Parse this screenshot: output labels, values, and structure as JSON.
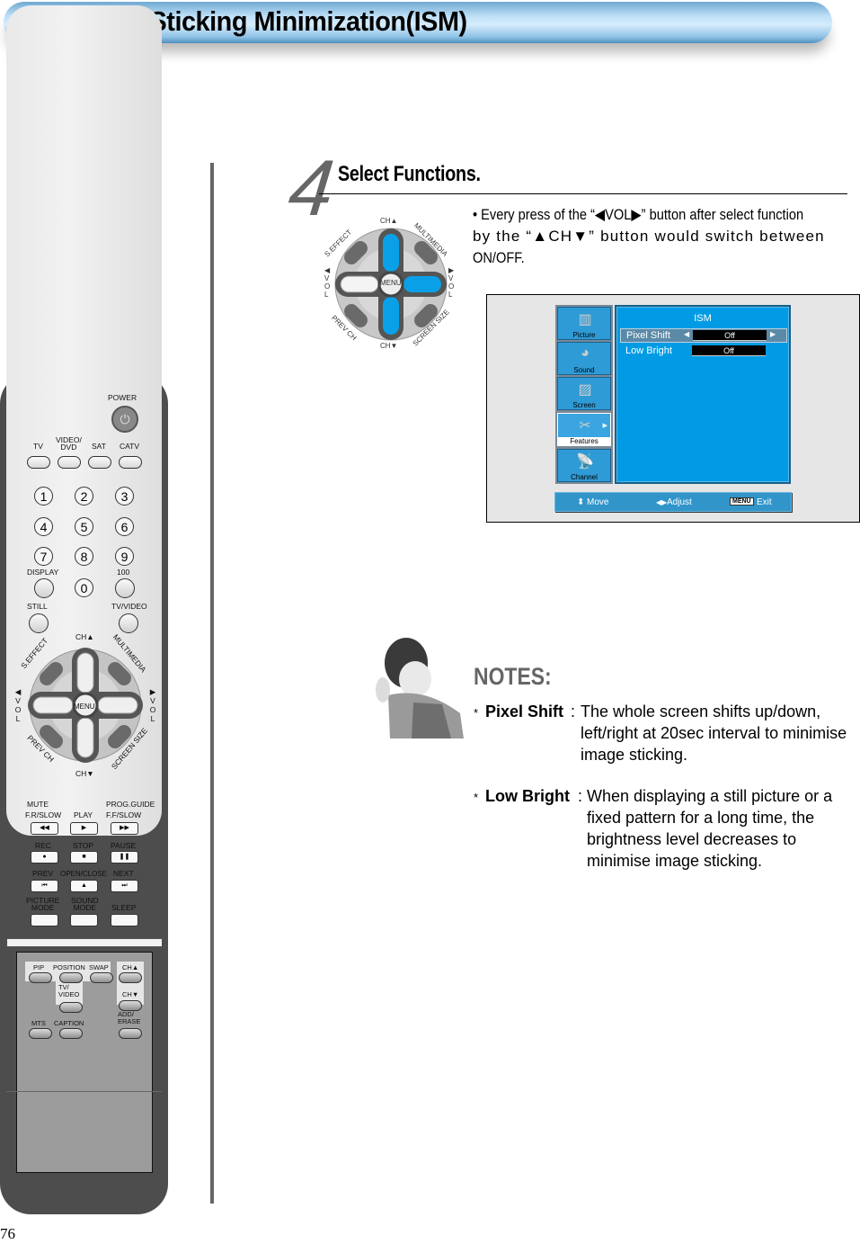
{
  "header": {
    "title": "Image Sticking Minimization(ISM)"
  },
  "step": {
    "number": "4",
    "title": "Select Functions.",
    "desc_line1": "• Every press of the “◀VOL▶” button after select function",
    "desc_line2": "by the “▲CH▼” button would switch between",
    "desc_line3": "ON/OFF."
  },
  "dpad": {
    "center": "MENU",
    "ch_up": "CH▲",
    "ch_down": "CH▼",
    "top_left": "S.EFFECT",
    "top_right": "MULTIMEDIA",
    "bottom_left": "PREV CH",
    "bottom_right": "SCREEN SIZE",
    "vol_left": "◀ V O L",
    "vol_right": "▶ V O L"
  },
  "osd": {
    "sidebar": [
      {
        "label": "Picture",
        "icon": "picture-icon",
        "active": false
      },
      {
        "label": "Sound",
        "icon": "sound-icon",
        "active": false
      },
      {
        "label": "Screen",
        "icon": "screen-icon",
        "active": false
      },
      {
        "label": "Features",
        "icon": "features-icon",
        "active": true
      },
      {
        "label": "Channel",
        "icon": "channel-icon",
        "active": false
      }
    ],
    "title": "ISM",
    "rows": [
      {
        "name": "Pixel Shift",
        "value": "Off",
        "selected": true
      },
      {
        "name": "Low Bright",
        "value": "Off",
        "selected": false
      }
    ],
    "footer": {
      "move": "Move",
      "adjust": "Adjust",
      "menu_chip": "MENU",
      "exit": "Exit"
    },
    "colors": {
      "panel": "#009be4",
      "frame": "#1a5f8a"
    }
  },
  "notes": {
    "title": "NOTES:",
    "items": [
      {
        "term": "Pixel Shift",
        "lines": [
          "The whole screen shifts up/down,",
          "left/right at 20sec interval to minimise",
          "image sticking."
        ]
      },
      {
        "term": "Low Bright",
        "lines": [
          "When displaying a still picture or a",
          "fixed pattern for a long time, the",
          "brightness level decreases to",
          "minimise image sticking."
        ]
      }
    ]
  },
  "remote": {
    "power": "POWER",
    "sources": [
      "TV",
      "VIDEO/\nDVD",
      "SAT",
      "CATV"
    ],
    "digits": [
      "1",
      "2",
      "3",
      "4",
      "5",
      "6",
      "7",
      "8",
      "9",
      "0"
    ],
    "display": "DISPLAY",
    "hundred": "100",
    "still": "STILL",
    "tv_video": "TV/VIDEO",
    "menu": "MENU",
    "ch_up": "CH▲",
    "ch_down": "CH▼",
    "s_effect": "S.EFFECT",
    "multimedia": "MULTIMEDIA",
    "prev_ch": "PREV CH",
    "screen_size": "SCREEN SIZE",
    "vol": "VOL",
    "mute": "MUTE",
    "prog_guide": "PROG.GUIDE",
    "transport": [
      {
        "label": "F.R/SLOW",
        "glyph": "◀◀"
      },
      {
        "label": "PLAY",
        "glyph": "▶"
      },
      {
        "label": "F.F/SLOW",
        "glyph": "▶▶"
      },
      {
        "label": "REC",
        "glyph": "●"
      },
      {
        "label": "STOP",
        "glyph": "■"
      },
      {
        "label": "PAUSE",
        "glyph": "❚❚"
      },
      {
        "label": "PREV",
        "glyph": "⏮"
      },
      {
        "label": "OPEN/CLOSE",
        "glyph": "▲"
      },
      {
        "label": "NEXT",
        "glyph": "⏭"
      }
    ],
    "picture_mode": "PICTURE\nMODE",
    "sound_mode": "SOUND\nMODE",
    "sleep": "SLEEP",
    "pip": {
      "pip": "PIP",
      "position": "POSITION",
      "swap": "SWAP",
      "ch_up": "CH▲",
      "tv_video": "TV/\nVIDEO",
      "ch_down": "CH▼",
      "mts": "MTS",
      "caption": "CAPTION",
      "add_erase": "ADD/\nERASE"
    }
  },
  "page_number": "76"
}
